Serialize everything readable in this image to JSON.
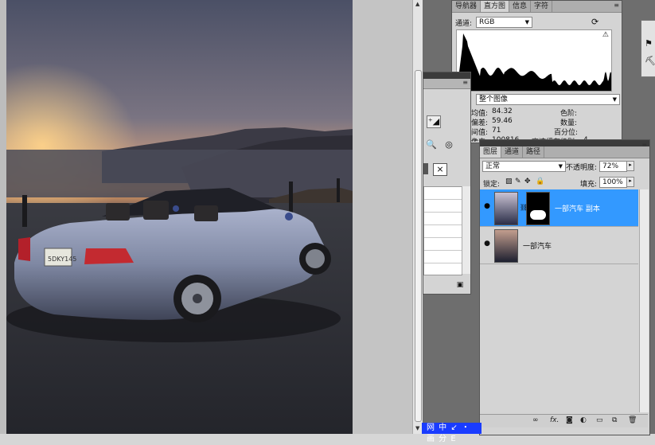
{
  "histogram_panel": {
    "tabs": [
      "导航器",
      "直方图",
      "信息",
      "字符"
    ],
    "active_tab": "直方图",
    "channel_label": "通道:",
    "channel_value": "RGB",
    "source_value": "整个图像",
    "stats": {
      "mean_label": "均值:",
      "mean_value": "84.32",
      "std_label": "偏差:",
      "std_value": "59.46",
      "median_label": "间值:",
      "median_value": "71",
      "pixels_label": "像素:",
      "pixels_value": "100816",
      "level_label": "色阶:",
      "count_label": "数量:",
      "percentile_label": "百分位:",
      "cache_label": "高速缓存级别:",
      "cache_value": "4"
    }
  },
  "layers_panel": {
    "tabs": [
      "图层",
      "通道",
      "路径"
    ],
    "active_tab": "图层",
    "blend_mode": "正常",
    "opacity_label": "不透明度:",
    "opacity_value": "72%",
    "lock_label": "锁定:",
    "fill_label": "填充:",
    "fill_value": "100%",
    "layers": [
      {
        "name": "一部汽车 副本",
        "selected": true
      },
      {
        "name": "一部汽车",
        "selected": false
      }
    ]
  },
  "ime_bar": {
    "text": "网 中 ↙ ・ 画 分 E"
  },
  "colors": {
    "selection": "#3399ff",
    "workspace": "#6e6e6e",
    "panel": "#d4d4d4"
  },
  "icons": [
    "eye-icon",
    "fx-icon",
    "mask-icon",
    "adjustment-icon",
    "folder-icon",
    "new-layer-icon",
    "trash-icon",
    "link-icon",
    "refresh-icon",
    "warning-icon"
  ]
}
